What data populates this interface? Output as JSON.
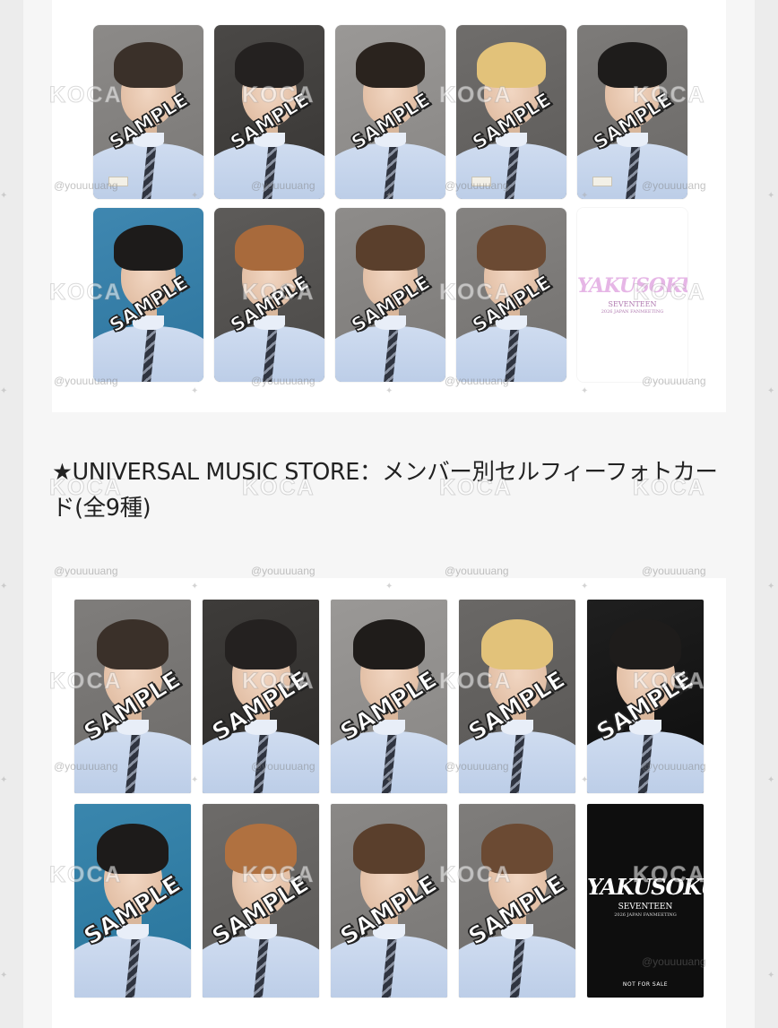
{
  "section_heading": "★UNIVERSAL MUSIC STORE：メンバー別セルフィーフォトカード(全9種)",
  "watermarks": {
    "handle": "@youuuuang",
    "brand": "KOCA"
  },
  "sample_label": "SAMPLE",
  "logo_card": {
    "title": "YAKUSOKU",
    "group": "SEVENTEEN",
    "event": "2026 JAPAN FANMEETING",
    "not_for_sale": "NOT FOR SALE"
  },
  "photo_sets": [
    {
      "name": "set-1",
      "cards": [
        {
          "hair": "#3a3029",
          "bg": "#8c8a88"
        },
        {
          "hair": "#242120",
          "bg": "#4a4846"
        },
        {
          "hair": "#2a231e",
          "bg": "#9a9896"
        },
        {
          "hair": "#e2c27a",
          "bg": "#6f6d6b"
        },
        {
          "hair": "#1e1c1b",
          "bg": "#7d7b79"
        },
        {
          "hair": "#1d1b1a",
          "bg": "#3f87b0"
        },
        {
          "hair": "#a86a3c",
          "bg": "#5d5b59"
        },
        {
          "hair": "#5a3f2c",
          "bg": "#8e8c8a"
        },
        {
          "hair": "#6b4a33",
          "bg": "#858381"
        }
      ]
    },
    {
      "name": "set-2",
      "cards": [
        {
          "hair": "#3a3029",
          "bg": "#7f7d7b"
        },
        {
          "hair": "#242120",
          "bg": "#3e3c3a"
        },
        {
          "hair": "#1f1c1a",
          "bg": "#9a9896"
        },
        {
          "hair": "#e2c27a",
          "bg": "#6a6866"
        },
        {
          "hair": "#1e1c1b",
          "bg": "#1f1f1f"
        },
        {
          "hair": "#1d1b1a",
          "bg": "#3a86ad"
        },
        {
          "hair": "#b07140",
          "bg": "#6d6b69"
        },
        {
          "hair": "#5a3f2c",
          "bg": "#8a8886"
        },
        {
          "hair": "#6b4a33",
          "bg": "#7f7d7b"
        }
      ]
    }
  ]
}
